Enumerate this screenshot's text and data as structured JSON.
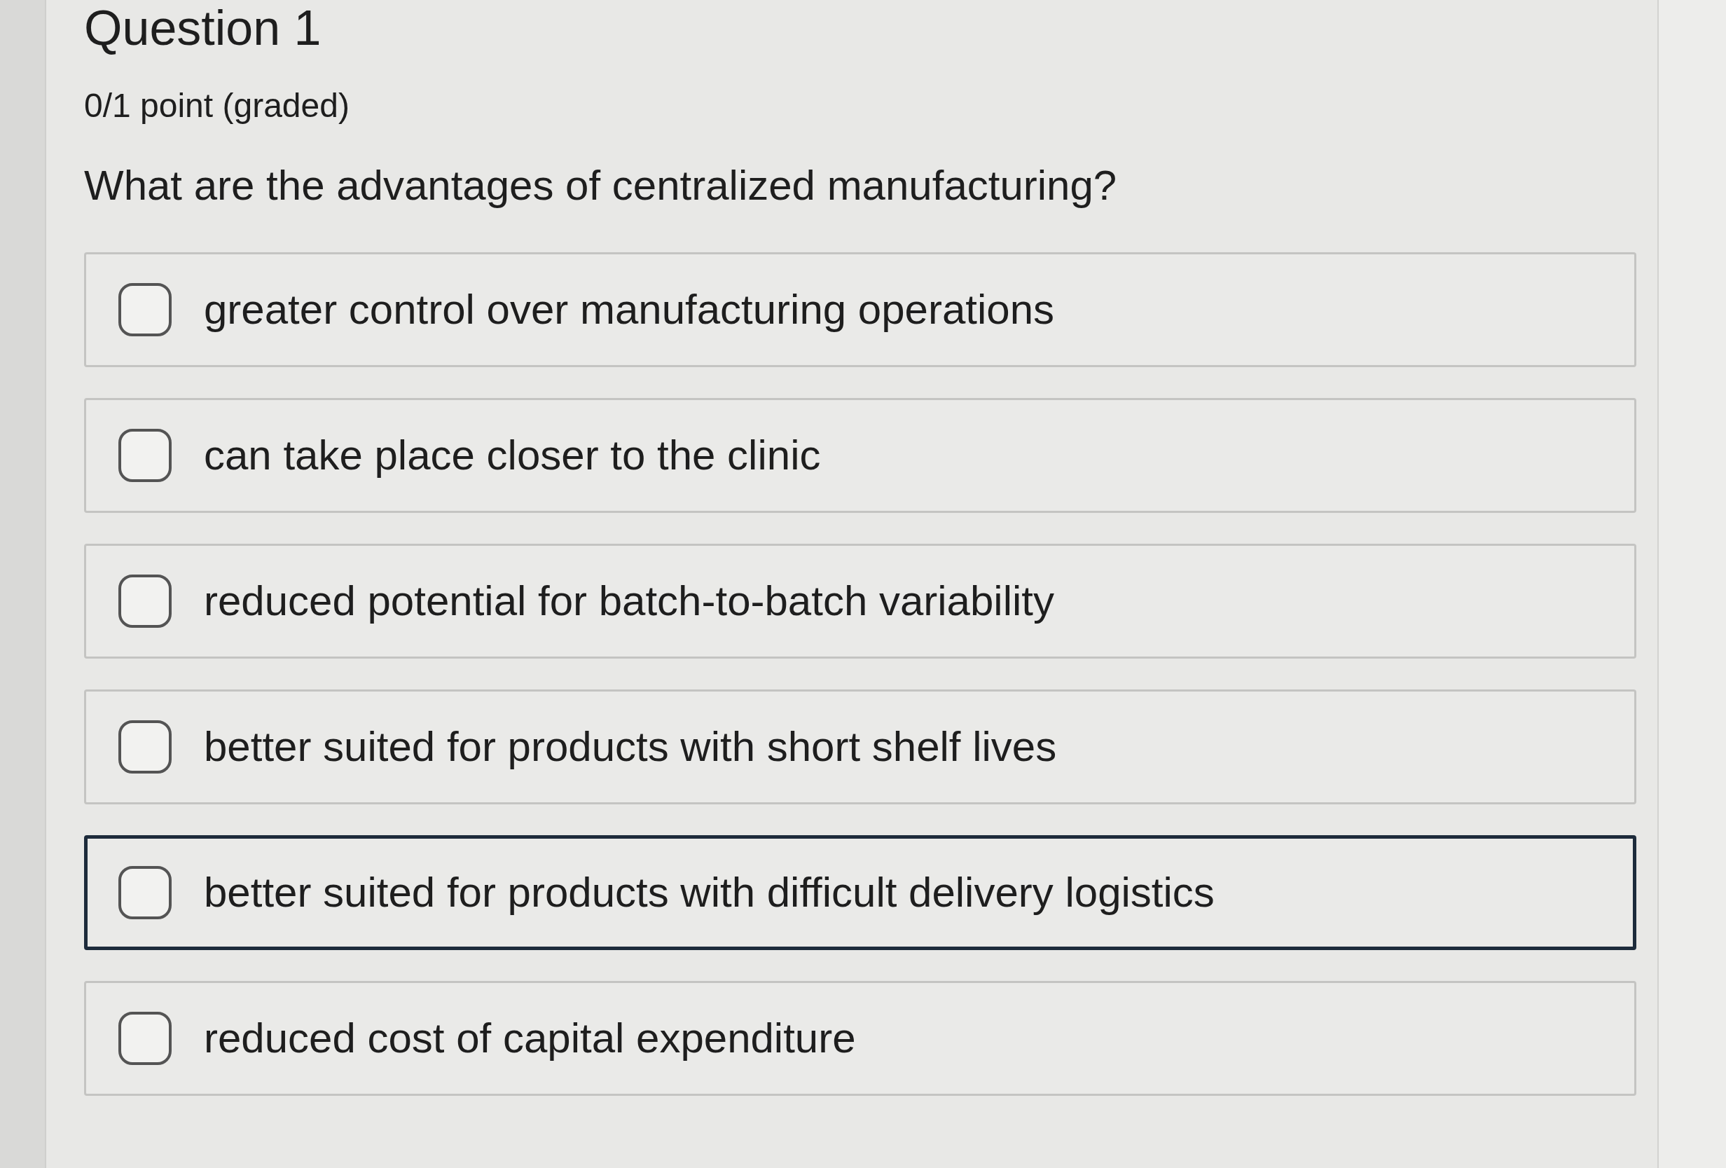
{
  "question": {
    "title": "Question 1",
    "points": "0/1 point (graded)",
    "prompt": "What are the advantages of centralized manufacturing?"
  },
  "options": [
    {
      "label": "greater control over manufacturing operations",
      "checked": false,
      "focused": false
    },
    {
      "label": "can take place closer to the clinic",
      "checked": false,
      "focused": false
    },
    {
      "label": "reduced potential for batch-to-batch variability",
      "checked": false,
      "focused": false
    },
    {
      "label": "better suited for products with short shelf lives",
      "checked": false,
      "focused": false
    },
    {
      "label": "better suited for products with difficult delivery logistics",
      "checked": false,
      "focused": true
    },
    {
      "label": "reduced cost of capital expenditure",
      "checked": false,
      "focused": false
    }
  ]
}
